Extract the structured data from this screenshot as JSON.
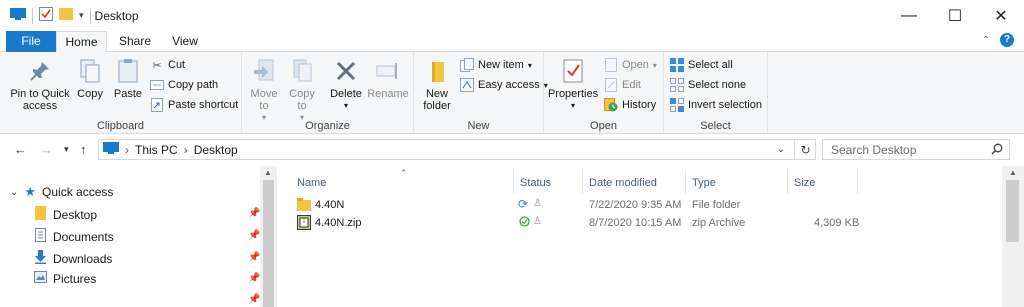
{
  "window": {
    "title": "Desktop",
    "controls": {
      "minimize": "—",
      "maximize": "☐",
      "close": "✕"
    }
  },
  "tabs": [
    "File",
    "Home",
    "Share",
    "View"
  ],
  "ribbon": {
    "clipboard": {
      "label": "Clipboard",
      "pin_label": "Pin to Quick access",
      "copy_label": "Copy",
      "paste_label": "Paste",
      "cut_label": "Cut",
      "copy_path_label": "Copy path",
      "paste_shortcut_label": "Paste shortcut"
    },
    "organize": {
      "label": "Organize",
      "move_to_label": "Move to",
      "copy_to_label": "Copy to",
      "delete_label": "Delete",
      "rename_label": "Rename"
    },
    "new": {
      "label": "New",
      "new_folder_label": "New folder",
      "new_item_label": "New item",
      "easy_access_label": "Easy access"
    },
    "open": {
      "label": "Open",
      "properties_label": "Properties",
      "open_label": "Open",
      "edit_label": "Edit",
      "history_label": "History"
    },
    "select": {
      "label": "Select",
      "select_all_label": "Select all",
      "select_none_label": "Select none",
      "invert_label": "Invert selection"
    }
  },
  "address": {
    "path": [
      "This PC",
      "Desktop"
    ],
    "search_placeholder": "Search Desktop"
  },
  "navpane": {
    "quick_access": "Quick access",
    "items": [
      {
        "label": "Desktop",
        "icon": "folder-icon"
      },
      {
        "label": "Documents",
        "icon": "document-icon"
      },
      {
        "label": "Downloads",
        "icon": "download-arrow-icon"
      },
      {
        "label": "Pictures",
        "icon": "picture-icon"
      }
    ]
  },
  "filelist": {
    "columns": [
      "Name",
      "Status",
      "Date modified",
      "Type",
      "Size"
    ],
    "rows": [
      {
        "name": "4.40N",
        "date": "7/22/2020 9:35 AM",
        "type": "File folder",
        "size": "",
        "icon": "folder-icon",
        "status_icon": "sync-icon"
      },
      {
        "name": "4.40N.zip",
        "date": "8/7/2020 10:15 AM",
        "type": "zip Archive",
        "size": "4,309 KB",
        "icon": "zip-icon",
        "status_icon": "check-circle-icon"
      }
    ]
  },
  "colors": {
    "accent": "#1979ca",
    "ribbon_bg": "#f5f6f7",
    "folder": "#f5c342",
    "sync": "#2f7fd0",
    "check": "#3a9b3a"
  }
}
